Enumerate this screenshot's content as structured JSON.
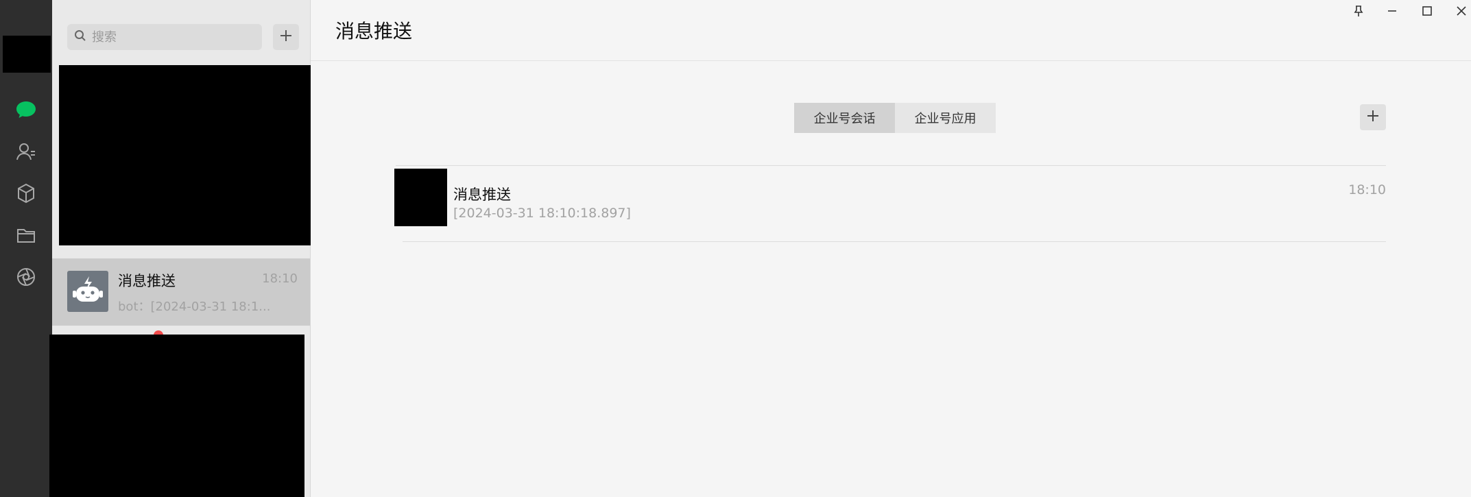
{
  "search": {
    "placeholder": "搜索"
  },
  "conversation": {
    "name": "消息推送",
    "time": "18:10",
    "preview": "bot：[2024-03-31 18:1..."
  },
  "main": {
    "title": "消息推送",
    "tabs": [
      {
        "label": "企业号会话",
        "active": true
      },
      {
        "label": "企业号应用",
        "active": false
      }
    ],
    "message": {
      "name": "消息推送",
      "detail": "[2024-03-31 18:10:18.897]",
      "time": "18:10"
    }
  },
  "nav": {
    "items": [
      "chat-icon",
      "contacts-icon",
      "cube-icon",
      "folder-icon",
      "aperture-icon"
    ],
    "active": "chat-icon",
    "active_color": "#07c160"
  },
  "colors": {
    "rail": "#2e2e2e",
    "list_bg": "#e9e9e9",
    "selected_item": "#cbcbcb",
    "unread": "#f24b4b"
  }
}
